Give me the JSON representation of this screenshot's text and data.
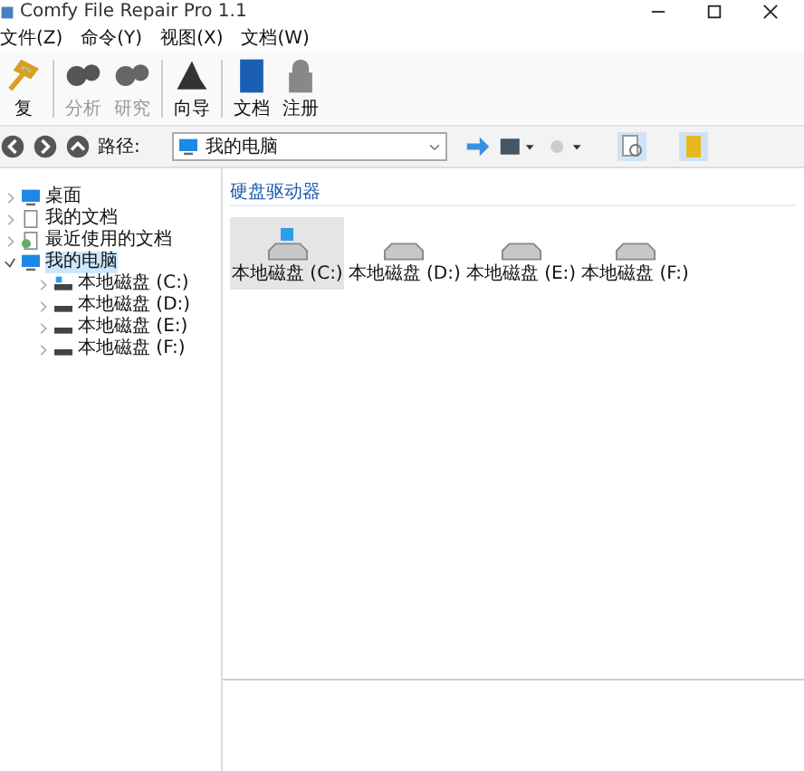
{
  "window": {
    "title": "Comfy File Repair Pro 1.1"
  },
  "menu": [
    "文件(Z)",
    "命令(Y)",
    "视图(X)",
    "文档(W)"
  ],
  "toolbar": [
    {
      "label": "复",
      "kind": "repair",
      "disabled": false
    },
    {
      "label": "分析",
      "kind": "analyze",
      "disabled": true
    },
    {
      "label": "研究",
      "kind": "research",
      "disabled": true
    },
    {
      "label": "向导",
      "kind": "wizard",
      "disabled": false
    },
    {
      "label": "文档",
      "kind": "docs",
      "disabled": false
    },
    {
      "label": "注册",
      "kind": "register",
      "disabled": false
    }
  ],
  "address": {
    "label": "路径:",
    "value": "我的电脑"
  },
  "tree": [
    {
      "label": "桌面",
      "kind": "desktop",
      "expanded": false,
      "selected": false
    },
    {
      "label": "我的文档",
      "kind": "docs",
      "expanded": false,
      "selected": false
    },
    {
      "label": "最近使用的文档",
      "kind": "recent",
      "expanded": false,
      "selected": false
    },
    {
      "label": "我的电脑",
      "kind": "computer",
      "expanded": true,
      "selected": true,
      "children": [
        {
          "label": "本地磁盘 (C:)",
          "kind": "sysdrive",
          "expanded": false,
          "selected": false
        },
        {
          "label": "本地磁盘 (D:)",
          "kind": "drive",
          "expanded": false,
          "selected": false
        },
        {
          "label": "本地磁盘 (E:)",
          "kind": "drive",
          "expanded": false,
          "selected": false
        },
        {
          "label": "本地磁盘 (F:)",
          "kind": "drive",
          "expanded": false,
          "selected": false
        }
      ]
    }
  ],
  "content": {
    "group": "硬盘驱动器",
    "drives": [
      {
        "label": "本地磁盘 (C:)",
        "kind": "sysdrive",
        "selected": true
      },
      {
        "label": "本地磁盘 (D:)",
        "kind": "drive",
        "selected": false
      },
      {
        "label": "本地磁盘 (E:)",
        "kind": "drive",
        "selected": false
      },
      {
        "label": "本地磁盘 (F:)",
        "kind": "drive",
        "selected": false
      }
    ]
  }
}
